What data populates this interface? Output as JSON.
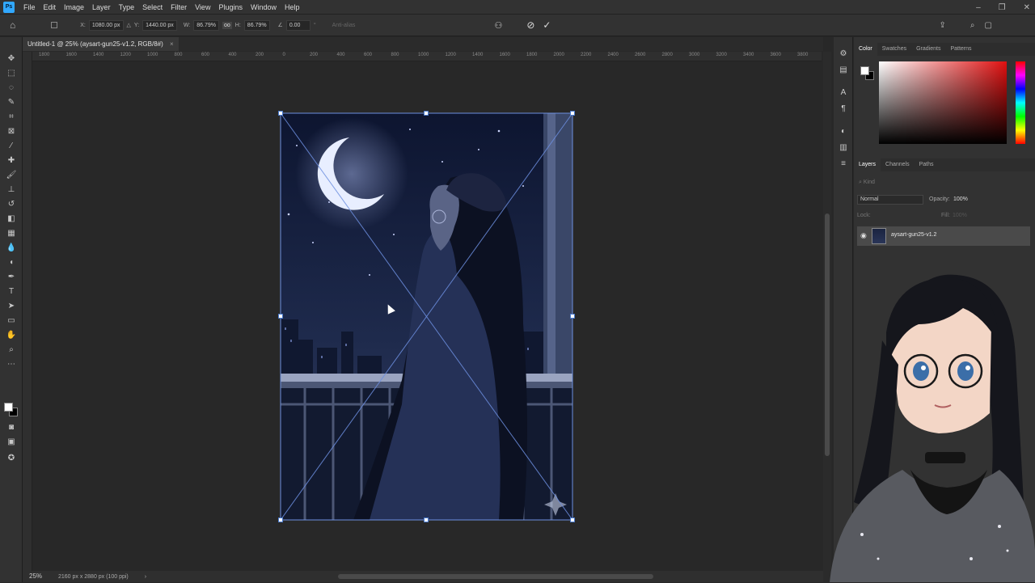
{
  "app": {
    "logo": "Ps"
  },
  "menu": [
    "File",
    "Edit",
    "Image",
    "Layer",
    "Type",
    "Select",
    "Filter",
    "View",
    "Plugins",
    "Window",
    "Help"
  ],
  "window_controls": {
    "minimize": "–",
    "restore": "❐",
    "close": "✕"
  },
  "options": {
    "x_label": "X:",
    "x_value": "1080.00 px",
    "y_label": "Y:",
    "y_value": "1440.00 px",
    "w_label": "W:",
    "w_value": "86.79%",
    "link_label": "oo",
    "h_label": "H:",
    "h_value": "86.79%",
    "angle_value": "0.00",
    "degree": "°",
    "antialias": "Anti-alias"
  },
  "document_tab": {
    "title": "Untitled-1 @ 25% (aysart-gun25-v1.2, RGB/8#)",
    "close": "×"
  },
  "ruler_ticks": [
    "1800",
    "1600",
    "1400",
    "1200",
    "1000",
    "800",
    "600",
    "400",
    "200",
    "0",
    "200",
    "400",
    "600",
    "800",
    "1000",
    "1200",
    "1400",
    "1600",
    "1800",
    "2000",
    "2200",
    "2400",
    "2600",
    "2800",
    "3000",
    "3200",
    "3400",
    "3600",
    "3800"
  ],
  "status": {
    "zoom": "25%",
    "doc_info": "2160 px x 2880 px (100 ppi)",
    "arrow": "›"
  },
  "panels": {
    "color_tabs": [
      "Color",
      "Swatches",
      "Gradients",
      "Patterns"
    ],
    "layers_tabs": [
      "Layers",
      "Channels",
      "Paths"
    ],
    "kind_placeholder": "Kind",
    "blend_mode": "Normal",
    "opacity_label": "Opacity:",
    "opacity_value": "100%",
    "lock_label": "Lock:",
    "fill_label": "Fill:",
    "fill_value": "100%",
    "layer_name": "aysart-gun25-v1.2"
  },
  "colors": {
    "accent": "#31a8ff",
    "transform": "#5b7fd6",
    "bg": "#282828",
    "panel": "#323232"
  }
}
